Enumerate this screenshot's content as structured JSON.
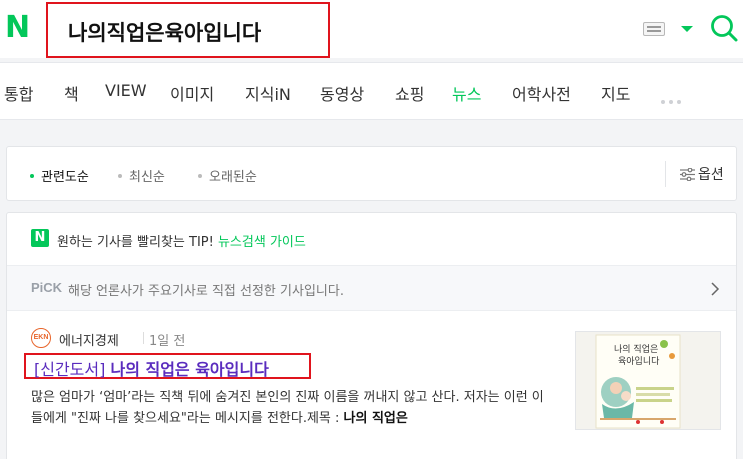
{
  "header": {
    "logo_text": "N",
    "search_query": "나의직업은육아입니다",
    "brand_color": "#03c75a",
    "highlight_color": "#e0141d"
  },
  "tabs": [
    {
      "label": "통합"
    },
    {
      "label": "책"
    },
    {
      "label": "VIEW"
    },
    {
      "label": "이미지"
    },
    {
      "label": "지식iN"
    },
    {
      "label": "동영상"
    },
    {
      "label": "쇼핑"
    },
    {
      "label": "뉴스",
      "active": true
    },
    {
      "label": "어학사전"
    },
    {
      "label": "지도"
    }
  ],
  "sort": {
    "options": [
      "관련도순",
      "최신순",
      "오래된순"
    ],
    "selected": "관련도순",
    "options_button": "옵션"
  },
  "tip": {
    "badge": "N",
    "text": "원하는 기사를 빨리찾는 TIP!",
    "link": "뉴스검색 가이드"
  },
  "pick": {
    "label": "PiCK",
    "text": "해당 언론사가 주요기사로 직접 선정한 기사입니다."
  },
  "article": {
    "press_logo": "EKN",
    "press_name": "에너지경제",
    "time": "1일 전",
    "headline_prefix": "[신간도서]",
    "headline_main": "나의 직업은 육아입니다",
    "snippet_1": "많은 엄마가 ‘엄마’라는 직책 뒤에 숨겨진 본인의 진짜 이름을 꺼내지 않고 산다. 저자는 이런 이들에게 \"진짜 나를 찾으세요\"라는 메시지를 전한다.제목 : ",
    "snippet_bold": "나의 직업은",
    "thumbnail": {
      "title_line1": "나의 직업은",
      "title_line2": "육아입니다"
    }
  }
}
